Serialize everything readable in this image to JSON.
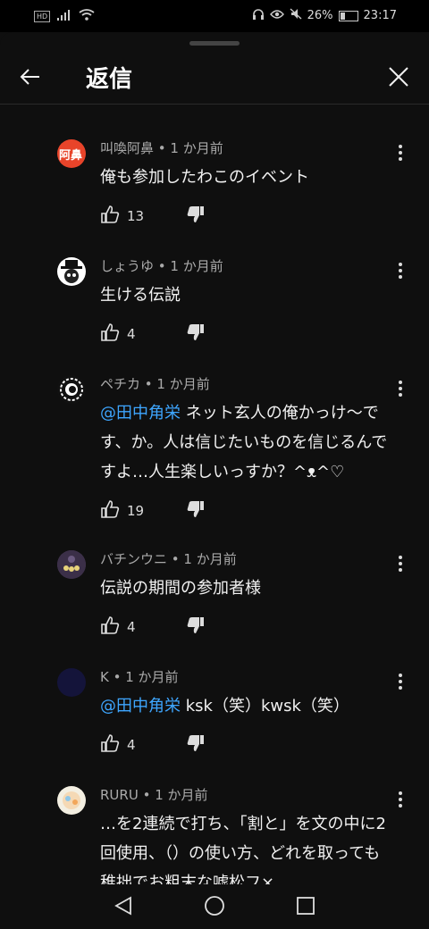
{
  "status": {
    "battery": "26%",
    "time": "23:17",
    "hd": "HD"
  },
  "header": {
    "title": "返信"
  },
  "comments": [
    {
      "author": "叫喚阿鼻",
      "time": "1 か月前",
      "text": "俺も参加したわこのイベント",
      "likes": "13",
      "avatar_text": "阿鼻",
      "avatar_color": "#e8442a"
    },
    {
      "author": "しょうゆ",
      "time": "1 か月前",
      "text": "生ける伝説",
      "likes": "4"
    },
    {
      "author": "ペチカ",
      "time": "1 か月前",
      "mention": "@田中角栄",
      "text": "ネット玄人の俺かっけ〜です、か。人は信じたいものを信じるんですよ…人生楽しいっすか？^ᴥ^♡",
      "likes": "19"
    },
    {
      "author": "バチンウニ",
      "time": "1 か月前",
      "text": "伝説の期間の参加者様",
      "likes": "4"
    },
    {
      "author": "K",
      "time": "1 か月前",
      "mention": "@田中角栄",
      "text": "ksk（笑）kwsk（笑）",
      "likes": "4"
    },
    {
      "author": "RURU",
      "time": "1 か月前",
      "text": "…を2連続で打ち、「割と」を文の中に2回使用、（）の使い方、どれを取っても稚拙でお粗末な嘘松フ×"
    }
  ],
  "separator": " • "
}
